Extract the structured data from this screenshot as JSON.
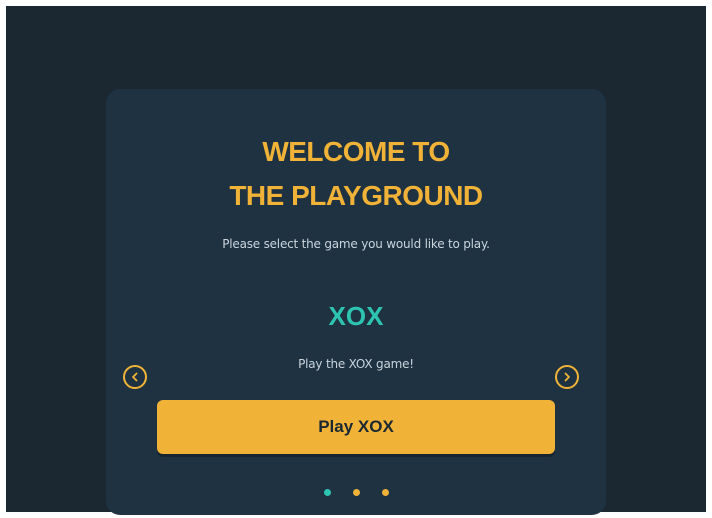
{
  "welcome": {
    "title_line1": "WELCOME TO",
    "title_line2": "THE PLAYGROUND",
    "subtitle": "Please select the game you would like to play."
  },
  "carousel": {
    "current_game": {
      "name": "XOX",
      "description": "Play the XOX game!",
      "button_label": "Play XOX"
    },
    "prev_icon": "chevron-left-icon",
    "next_icon": "chevron-right-icon",
    "dots": [
      {
        "active": true,
        "color": "#2ec4b2"
      },
      {
        "active": false,
        "color": "#f0b338"
      },
      {
        "active": false,
        "color": "#f0b338"
      }
    ]
  },
  "colors": {
    "background": "#1b2731",
    "card": "#1f3242",
    "accent": "#f0b338",
    "teal": "#2ec4b2",
    "text_muted": "#c9d4dc"
  }
}
